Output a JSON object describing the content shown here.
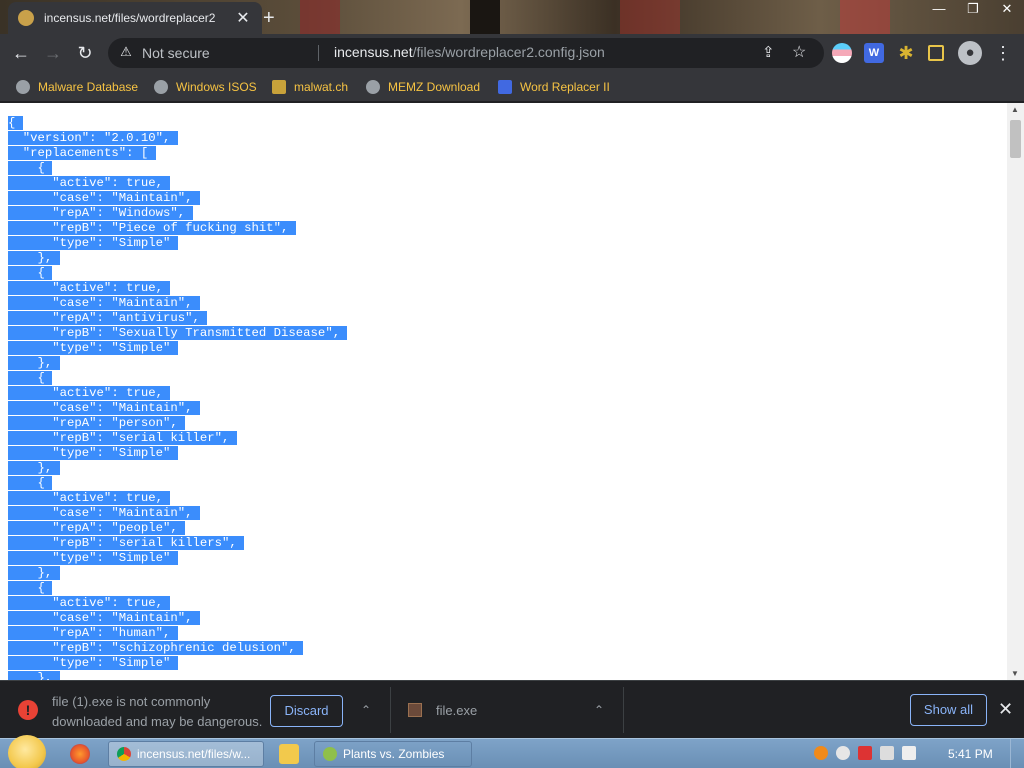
{
  "browser": {
    "tab_title": "incensus.net/files/wordreplacer2",
    "tab_close": "✕",
    "new_tab": "+",
    "window_controls": [
      "—",
      "❐",
      "✕"
    ],
    "security_label": "Not secure",
    "url_host": "incensus.net",
    "url_path": "/files/wordreplacer2.config.json"
  },
  "toolbar": {
    "back_icon": "←",
    "forward_icon": "→",
    "reload_icon": "↻",
    "warn_icon": "⚠",
    "share_icon": "⇪",
    "star_icon": "☆",
    "wr_ext_label": "W",
    "puzzle_icon": "✱",
    "profile_icon": "●",
    "menu_icon": "⋮"
  },
  "bookmarks": [
    {
      "label": "Malware Database",
      "icon": "globe-icon"
    },
    {
      "label": "Windows ISOS",
      "icon": "globe-icon"
    },
    {
      "label": "malwat.ch",
      "icon": "figure-icon"
    },
    {
      "label": "MEMZ Download",
      "icon": "globe-icon"
    },
    {
      "label": "Word Replacer II",
      "icon": "wr-icon"
    }
  ],
  "json_lines": [
    "{",
    "  \"version\": \"2.0.10\",",
    "  \"replacements\": [",
    "    {",
    "      \"active\": true,",
    "      \"case\": \"Maintain\",",
    "      \"repA\": \"Windows\",",
    "      \"repB\": \"Piece of fucking shit\",",
    "      \"type\": \"Simple\"",
    "    },",
    "    {",
    "      \"active\": true,",
    "      \"case\": \"Maintain\",",
    "      \"repA\": \"antivirus\",",
    "      \"repB\": \"Sexually Transmitted Disease\",",
    "      \"type\": \"Simple\"",
    "    },",
    "    {",
    "      \"active\": true,",
    "      \"case\": \"Maintain\",",
    "      \"repA\": \"person\",",
    "      \"repB\": \"serial killer\",",
    "      \"type\": \"Simple\"",
    "    },",
    "    {",
    "      \"active\": true,",
    "      \"case\": \"Maintain\",",
    "      \"repA\": \"people\",",
    "      \"repB\": \"serial killers\",",
    "      \"type\": \"Simple\"",
    "    },",
    "    {",
    "      \"active\": true,",
    "      \"case\": \"Maintain\",",
    "      \"repA\": \"human\",",
    "      \"repB\": \"schizophrenic delusion\",",
    "      \"type\": \"Simple\"",
    "    },"
  ],
  "download_bar": {
    "warning_icon": "!",
    "warning_text": "file (1).exe is not commonly downloaded and may be dangerous.",
    "discard_label": "Discard",
    "chevron": "⌃",
    "file_name": "file.exe",
    "show_all_label": "Show all",
    "close_icon": "✕"
  },
  "taskbar": {
    "tasks": [
      {
        "label": "incensus.net/files/w...",
        "active": true
      },
      {
        "label": "Plants vs. Zombies",
        "active": false
      }
    ],
    "clock": "5:41 PM"
  },
  "colors": {
    "selection": "#3b8dfc",
    "bookmark_text": "#f6c343",
    "download_accent": "#8ab4f8",
    "danger": "#e94235"
  }
}
